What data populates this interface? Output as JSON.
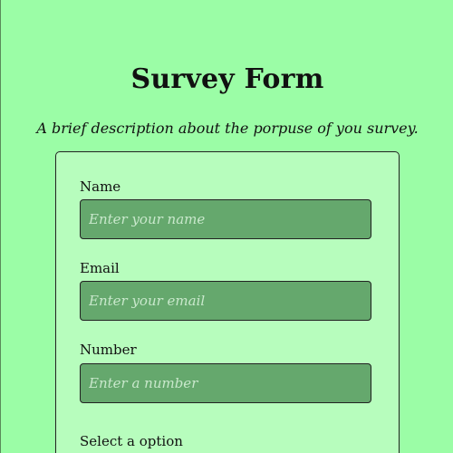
{
  "header": {
    "title": "Survey Form",
    "description": "A brief description about the porpuse of you survey."
  },
  "form": {
    "name": {
      "label": "Name",
      "placeholder": "Enter your name",
      "value": ""
    },
    "email": {
      "label": "Email",
      "placeholder": "Enter your email",
      "value": ""
    },
    "number": {
      "label": "Number",
      "placeholder": "Enter a number",
      "value": ""
    },
    "select": {
      "label": "Select a option"
    }
  },
  "colors": {
    "page_background": "#9bfda6",
    "card_background": "#b7fdbd",
    "input_background": "#65a86d"
  }
}
